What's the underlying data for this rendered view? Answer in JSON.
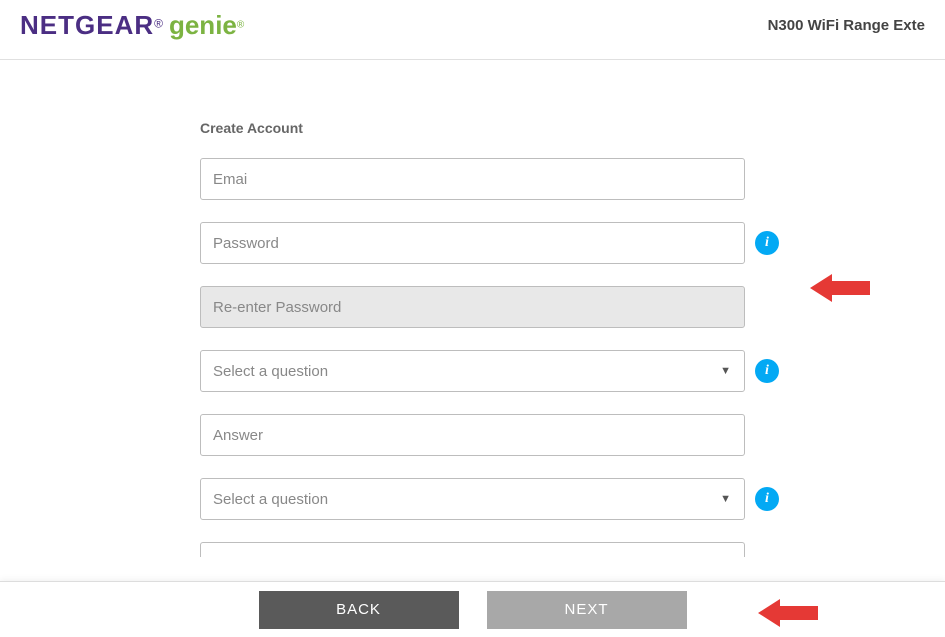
{
  "header": {
    "brand1": "NETGEAR",
    "brand2": "genie",
    "product": "N300 WiFi Range Exte"
  },
  "form": {
    "title": "Create Account",
    "email_placeholder": "Emai",
    "password_placeholder": "Password",
    "reenter_placeholder": "Re-enter Password",
    "question1_placeholder": "Select a question",
    "answer_placeholder": "Answer",
    "question2_placeholder": "Select a question"
  },
  "info_label": "i",
  "footer": {
    "back": "BACK",
    "next": "NEXT"
  }
}
